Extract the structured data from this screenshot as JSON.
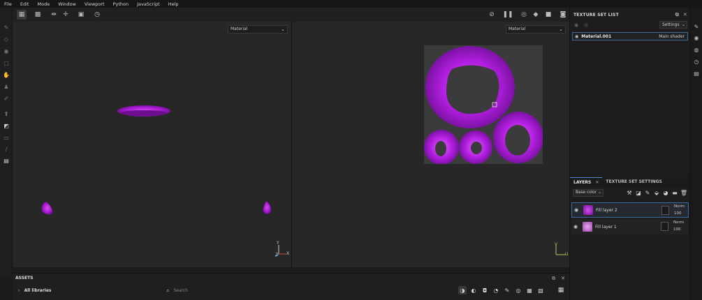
{
  "menu": [
    "File",
    "Edit",
    "Mode",
    "Window",
    "Viewport",
    "Python",
    "JavaScript",
    "Help"
  ],
  "viewport3d": {
    "material_select": "Material",
    "axis_y": "Y",
    "axis_x": "X",
    "axis_z": "Z"
  },
  "viewport2d": {
    "material_select": "Material",
    "axis_u": "U",
    "axis_v": "V"
  },
  "texture_set_list": {
    "title": "TEXTURE SET LIST",
    "settings_label": "Settings",
    "items": [
      {
        "name": "Material.001",
        "shader": "Main shader"
      }
    ]
  },
  "layers_panel": {
    "tabs": [
      "LAYERS",
      "TEXTURE SET SETTINGS"
    ],
    "channel": "Base color",
    "layers": [
      {
        "name": "Fill layer 2",
        "blend": "Norm",
        "opacity": "100"
      },
      {
        "name": "Fill layer 1",
        "blend": "Norm",
        "opacity": "100"
      }
    ]
  },
  "assets": {
    "title": "ASSETS",
    "library": "All libraries",
    "search_placeholder": "Search"
  },
  "colors": {
    "accent": "#3d6a9c",
    "magenta": "#b21ee0",
    "background": "#272727"
  }
}
